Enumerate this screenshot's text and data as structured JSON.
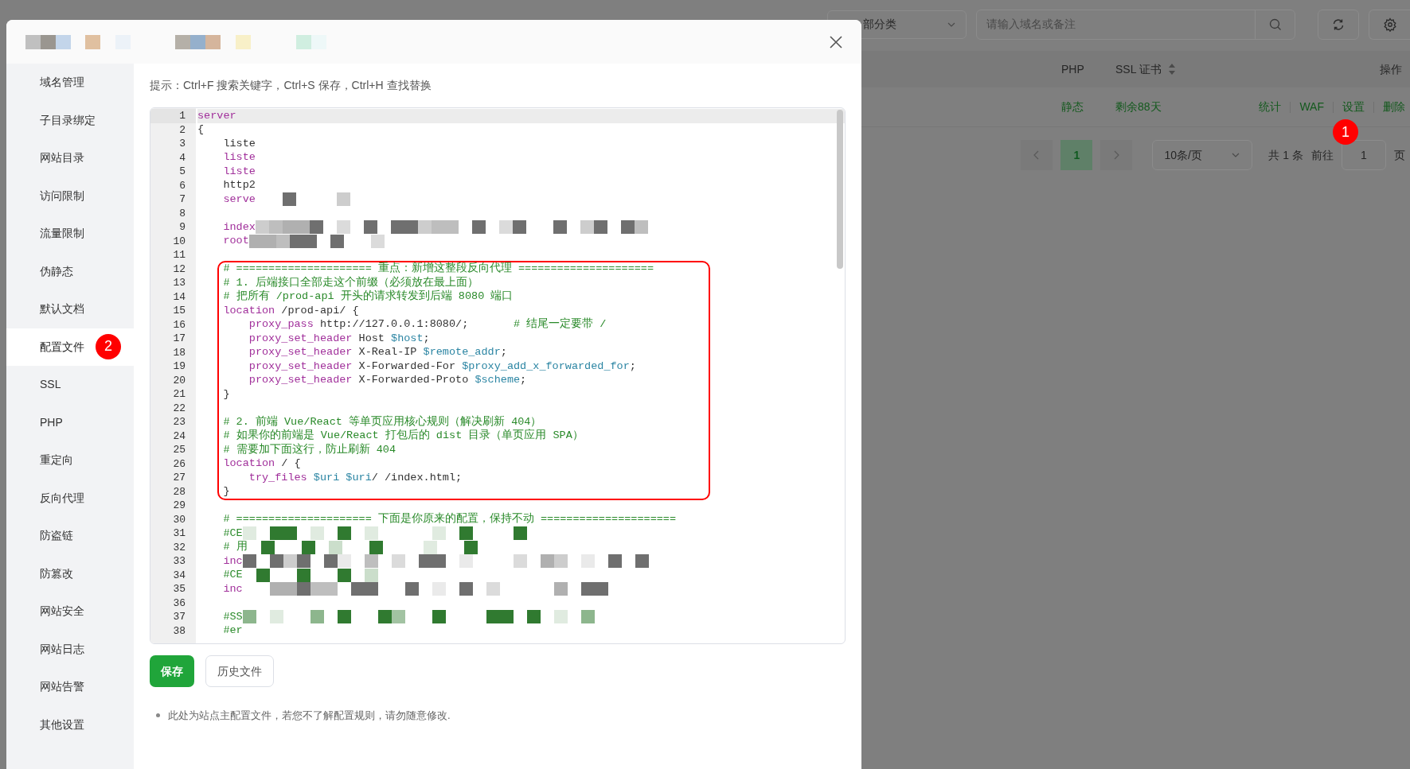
{
  "background_page": {
    "category_select": "部分类",
    "search": {
      "placeholder": "请输入域名或备注"
    },
    "table": {
      "columns": [
        "PHP",
        "SSL 证书",
        "操作"
      ],
      "rows": [
        {
          "php": "静态",
          "ssl": "剩余88天",
          "actions": [
            {
              "label": "统计"
            },
            {
              "label": "WAF"
            },
            {
              "label": "设置",
              "badge": "1"
            },
            {
              "label": "删除"
            }
          ]
        }
      ]
    },
    "pagination": {
      "pages": [
        {
          "label": "1",
          "selected": true
        }
      ],
      "page_size": "10条/页",
      "total": "共 1 条",
      "goto_label": "前往",
      "goto_value": "1",
      "page_suffix": "页"
    }
  },
  "dialog": {
    "sidebar": [
      {
        "label": "域名管理",
        "selected": false
      },
      {
        "label": "子目录绑定",
        "selected": false
      },
      {
        "label": "网站目录",
        "selected": false
      },
      {
        "label": "访问限制",
        "selected": false
      },
      {
        "label": "流量限制",
        "selected": false
      },
      {
        "label": "伪静态",
        "selected": false
      },
      {
        "label": "默认文档",
        "selected": false
      },
      {
        "label": "配置文件",
        "selected": true,
        "badge": "2"
      },
      {
        "label": "SSL",
        "selected": false
      },
      {
        "label": "PHP",
        "selected": false
      },
      {
        "label": "重定向",
        "selected": false
      },
      {
        "label": "反向代理",
        "selected": false
      },
      {
        "label": "防盗链",
        "selected": false
      },
      {
        "label": "防篡改",
        "selected": false
      },
      {
        "label": "网站安全",
        "selected": false
      },
      {
        "label": "网站日志",
        "selected": false
      },
      {
        "label": "网站告警",
        "selected": false
      },
      {
        "label": "其他设置",
        "selected": false
      }
    ],
    "hint": "提示：Ctrl+F 搜索关键字，Ctrl+S 保存，Ctrl+H 查找替换",
    "editor": {
      "blocks": [
        {
          "boxed": false,
          "lines": [
            {
              "n": "1",
              "active": true,
              "segs": [
                {
                  "kind": "keyword",
                  "t": "server"
                }
              ]
            },
            {
              "n": "2",
              "active": false,
              "segs": [
                {
                  "kind": "plain",
                  "t": "{"
                }
              ]
            },
            {
              "n": "3",
              "active": false,
              "segs": [
                {
                  "kind": "plain",
                  "t": "    liste"
                }
              ]
            },
            {
              "n": "4",
              "active": false,
              "segs": [
                {
                  "kind": "keyword",
                  "t": "    liste"
                }
              ]
            },
            {
              "n": "5",
              "active": false,
              "segs": [
                {
                  "kind": "keyword",
                  "t": "    liste"
                }
              ]
            },
            {
              "n": "6",
              "active": false,
              "segs": [
                {
                  "kind": "plain",
                  "t": "    http2"
                }
              ]
            },
            {
              "n": "7",
              "active": false,
              "segs": [
                {
                  "kind": "keyword",
                  "t": "    serve"
                },
                {
                  "kind": "mosaic",
                  "color": "#6f6f6f"
                }
              ]
            },
            {
              "n": "8",
              "active": false
            },
            {
              "n": "9",
              "active": false,
              "segs": [
                {
                  "kind": "keyword",
                  "t": "    index"
                },
                {
                  "kind": "mosaic",
                  "color": "#6f6f6f"
                }
              ]
            },
            {
              "n": "10",
              "active": false,
              "segs": [
                {
                  "kind": "keyword",
                  "t": "    root"
                },
                {
                  "kind": "mosaic",
                  "color": "#6f6f6f"
                }
              ]
            },
            {
              "n": "11",
              "active": false
            }
          ]
        },
        {
          "boxed": true,
          "lines": [
            {
              "n": "12",
              "active": false,
              "segs": [
                {
                  "kind": "comment",
                  "t": "    # ===================== 重点：新增这整段反向代理 ====================="
                }
              ]
            },
            {
              "n": "13",
              "active": false,
              "segs": [
                {
                  "kind": "comment",
                  "t": "    # 1. 后端接口全部走这个前缀（必须放在最上面）"
                }
              ]
            },
            {
              "n": "14",
              "active": false,
              "segs": [
                {
                  "kind": "comment",
                  "t": "    # 把所有 /prod-api 开头的请求转发到后端 8080 端口"
                }
              ]
            },
            {
              "n": "15",
              "active": false,
              "segs": [
                {
                  "kind": "keyword",
                  "t": "    location"
                },
                {
                  "kind": "plain",
                  "t": " /prod-api/ {"
                }
              ]
            },
            {
              "n": "16",
              "active": false,
              "segs": [
                {
                  "kind": "keyword",
                  "t": "        proxy_pass"
                },
                {
                  "kind": "plain",
                  "t": " http://127.0.0.1:8080/;       "
                },
                {
                  "kind": "comment",
                  "t": "# 结尾一定要带 /"
                }
              ]
            },
            {
              "n": "17",
              "active": false,
              "segs": [
                {
                  "kind": "keyword",
                  "t": "        proxy_set_header"
                },
                {
                  "kind": "plain",
                  "t": " Host "
                },
                {
                  "kind": "variable",
                  "t": "$host"
                },
                {
                  "kind": "plain",
                  "t": ";"
                }
              ]
            },
            {
              "n": "18",
              "active": false,
              "segs": [
                {
                  "kind": "keyword",
                  "t": "        proxy_set_header"
                },
                {
                  "kind": "plain",
                  "t": " X-Real-IP "
                },
                {
                  "kind": "variable",
                  "t": "$remote_addr"
                },
                {
                  "kind": "plain",
                  "t": ";"
                }
              ]
            },
            {
              "n": "19",
              "active": false,
              "segs": [
                {
                  "kind": "keyword",
                  "t": "        proxy_set_header"
                },
                {
                  "kind": "plain",
                  "t": " X-Forwarded-For "
                },
                {
                  "kind": "variable",
                  "t": "$proxy_add_x_forwarded_for"
                },
                {
                  "kind": "plain",
                  "t": ";"
                }
              ]
            },
            {
              "n": "20",
              "active": false,
              "segs": [
                {
                  "kind": "keyword",
                  "t": "        proxy_set_header"
                },
                {
                  "kind": "plain",
                  "t": " X-Forwarded-Proto "
                },
                {
                  "kind": "variable",
                  "t": "$scheme"
                },
                {
                  "kind": "plain",
                  "t": ";"
                }
              ]
            },
            {
              "n": "21",
              "active": false,
              "segs": [
                {
                  "kind": "plain",
                  "t": "    }"
                }
              ]
            },
            {
              "n": "22",
              "active": false
            },
            {
              "n": "23",
              "active": false,
              "segs": [
                {
                  "kind": "comment",
                  "t": "    # 2. 前端 Vue/React 等单页应用核心规则（解决刷新 404）"
                }
              ]
            },
            {
              "n": "24",
              "active": false,
              "segs": [
                {
                  "kind": "comment",
                  "t": "    # 如果你的前端是 Vue/React 打包后的 dist 目录（单页应用 SPA）"
                }
              ]
            },
            {
              "n": "25",
              "active": false,
              "segs": [
                {
                  "kind": "comment",
                  "t": "    # 需要加下面这行，防止刷新 404"
                }
              ]
            },
            {
              "n": "26",
              "active": false,
              "segs": [
                {
                  "kind": "keyword",
                  "t": "    location"
                },
                {
                  "kind": "plain",
                  "t": " / {"
                }
              ]
            },
            {
              "n": "27",
              "active": false,
              "segs": [
                {
                  "kind": "keyword",
                  "t": "        try_files"
                },
                {
                  "kind": "variable",
                  "t": " $uri $uri"
                },
                {
                  "kind": "plain",
                  "t": "/ /index.html;"
                }
              ]
            },
            {
              "n": "28",
              "active": false,
              "segs": [
                {
                  "kind": "plain",
                  "t": "    }"
                }
              ]
            }
          ]
        },
        {
          "boxed": false,
          "lines": [
            {
              "n": "29",
              "active": false
            },
            {
              "n": "30",
              "active": false,
              "segs": [
                {
                  "kind": "comment",
                  "t": "    # ===================== 下面是你原来的配置，保持不动 ====================="
                }
              ]
            },
            {
              "n": "31",
              "active": false,
              "segs": [
                {
                  "kind": "comment",
                  "t": "    #CE"
                },
                {
                  "kind": "mosaic",
                  "color": "#307a30"
                }
              ]
            },
            {
              "n": "32",
              "active": false,
              "segs": [
                {
                  "kind": "comment",
                  "t": "    # 用"
                },
                {
                  "kind": "mosaic",
                  "color": "#307a30"
                }
              ]
            },
            {
              "n": "33",
              "active": false,
              "segs": [
                {
                  "kind": "keyword",
                  "t": "    inc"
                },
                {
                  "kind": "mosaic",
                  "color": "#6f6f6f"
                }
              ]
            },
            {
              "n": "34",
              "active": false,
              "segs": [
                {
                  "kind": "comment",
                  "t": "    #CE"
                },
                {
                  "kind": "mosaic",
                  "color": "#307a30"
                }
              ]
            },
            {
              "n": "35",
              "active": false,
              "segs": [
                {
                  "kind": "keyword",
                  "t": "    inc"
                },
                {
                  "kind": "mosaic",
                  "color": "#6f6f6f"
                }
              ]
            },
            {
              "n": "36",
              "active": false
            },
            {
              "n": "37",
              "active": false,
              "segs": [
                {
                  "kind": "comment",
                  "t": "    #SS"
                },
                {
                  "kind": "mosaic",
                  "color": "#307a30"
                }
              ]
            },
            {
              "n": "38",
              "active": false,
              "segs": [
                {
                  "kind": "comment",
                  "t": "    #er"
                }
              ]
            }
          ]
        }
      ]
    },
    "buttons": [
      {
        "label": "保存",
        "kind": "primary"
      },
      {
        "label": "历史文件",
        "kind": "default"
      }
    ],
    "notes": [
      "此处为站点主配置文件，若您不了解配置规则，请勿随意修改."
    ]
  }
}
